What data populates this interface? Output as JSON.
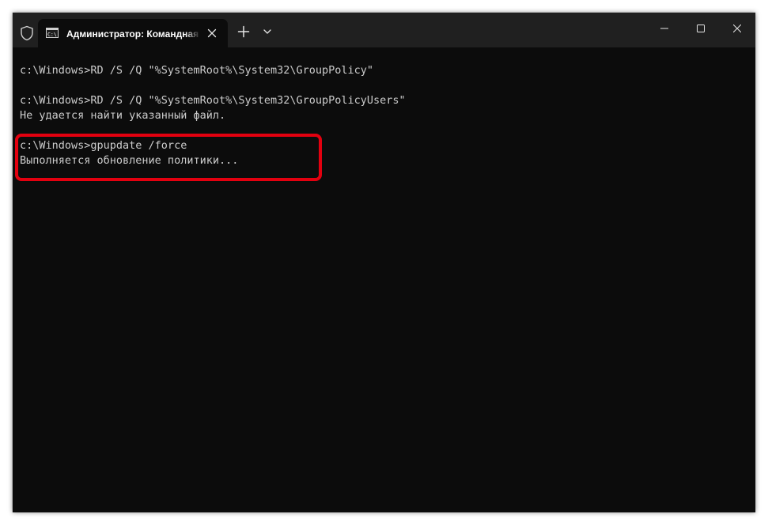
{
  "titlebar": {
    "tab_title": "Администратор: Командная строка"
  },
  "terminal": {
    "lines": [
      "",
      "c:\\Windows>RD /S /Q \"%SystemRoot%\\System32\\GroupPolicy\"",
      "",
      "c:\\Windows>RD /S /Q \"%SystemRoot%\\System32\\GroupPolicyUsers\"",
      "Не удается найти указанный файл.",
      "",
      "c:\\Windows>gpupdate /force",
      "Выполняется обновление политики..."
    ]
  },
  "colors": {
    "terminal_bg": "#0c0c0c",
    "titlebar_bg": "#202020",
    "text": "#cccccc",
    "highlight": "#e3000f"
  },
  "icons": {
    "shield": "shield-icon",
    "tab": "cmd-icon",
    "tab_close": "close-icon",
    "new_tab": "plus-icon",
    "dropdown": "chevron-down-icon",
    "minimize": "minimize-icon",
    "maximize": "maximize-icon",
    "close": "close-icon"
  }
}
